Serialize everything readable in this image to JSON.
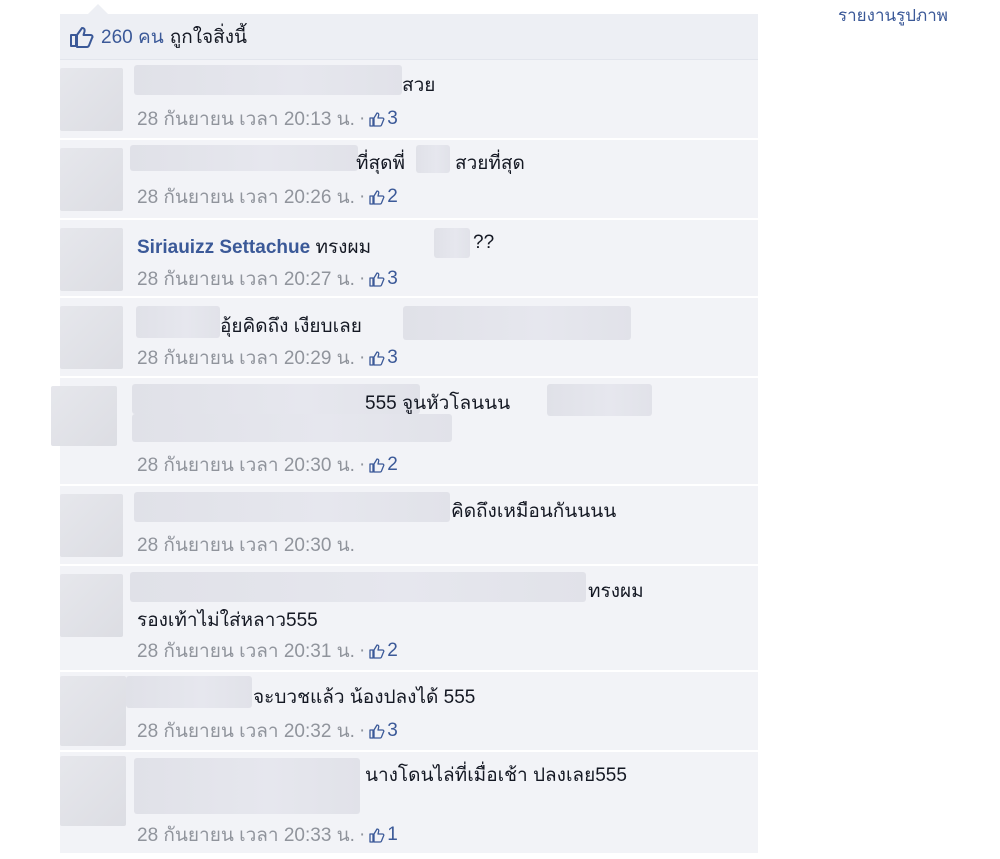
{
  "header": {
    "report_photo": "รายงานรูปภาพ"
  },
  "likes": {
    "count": "260 คน",
    "text": "ถูกใจสิ่งนี้"
  },
  "comments": [
    {
      "text": "สวย",
      "time": "28 กันยายน เวลา 20:13 น.",
      "likes": "3"
    },
    {
      "text": "ที่สุดพี่",
      "text2": "สวยที่สุด",
      "time": "28 กันยายน เวลา 20:26 น.",
      "likes": "2"
    },
    {
      "author": "Siriauizz Settachue",
      "text": "ทรงผม",
      "text2": "??",
      "time": "28 กันยายน เวลา 20:27 น.",
      "likes": "3"
    },
    {
      "text": "อุ้ยคิดถึง เงียบเลย",
      "time": "28 กันยายน เวลา 20:29 น.",
      "likes": "3"
    },
    {
      "text": "555 จูนหัวโลนนน",
      "time": "28 กันยายน เวลา 20:30 น.",
      "likes": "2"
    },
    {
      "text": "คิดถึงเหมือนกันนนน",
      "time": "28 กันยายน เวลา 20:30 น."
    },
    {
      "text": "ทรงผม",
      "text2": "รองเท้าไม่ใส่หลาว555",
      "time": "28 กันยายน เวลา 20:31 น.",
      "likes": "2"
    },
    {
      "text": "จะบวชแล้ว น้องปลงได้ 555",
      "time": "28 กันยายน เวลา 20:32 น.",
      "likes": "3"
    },
    {
      "text": "นางโดนไล่ที่เมื่อเช้า ปลงเลย555",
      "time": "28 กันยายน เวลา 20:33 น.",
      "likes": "1"
    }
  ]
}
